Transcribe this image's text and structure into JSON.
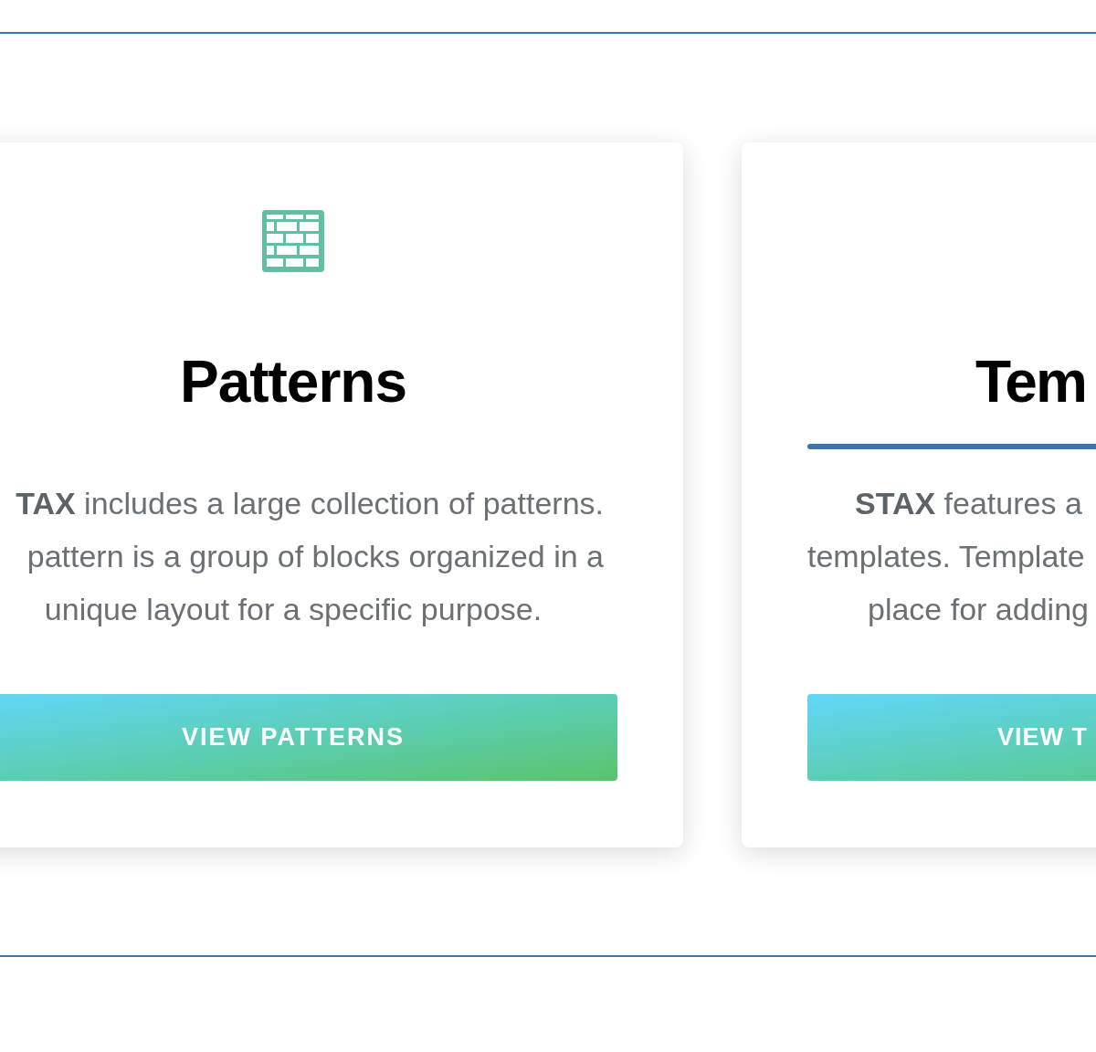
{
  "cards": [
    {
      "title": "Patterns",
      "underline": false,
      "lines": [
        "**TAX** includes a large collection of patterns.",
        "pattern is a group of blocks organized in a",
        "unique layout for a specific purpose."
      ],
      "button": "VIEW PATTERNS"
    },
    {
      "title": "Tem",
      "underline": true,
      "lines": [
        "**STAX** features a",
        "templates. Template",
        "place for adding"
      ],
      "button": "VIEW T"
    }
  ]
}
